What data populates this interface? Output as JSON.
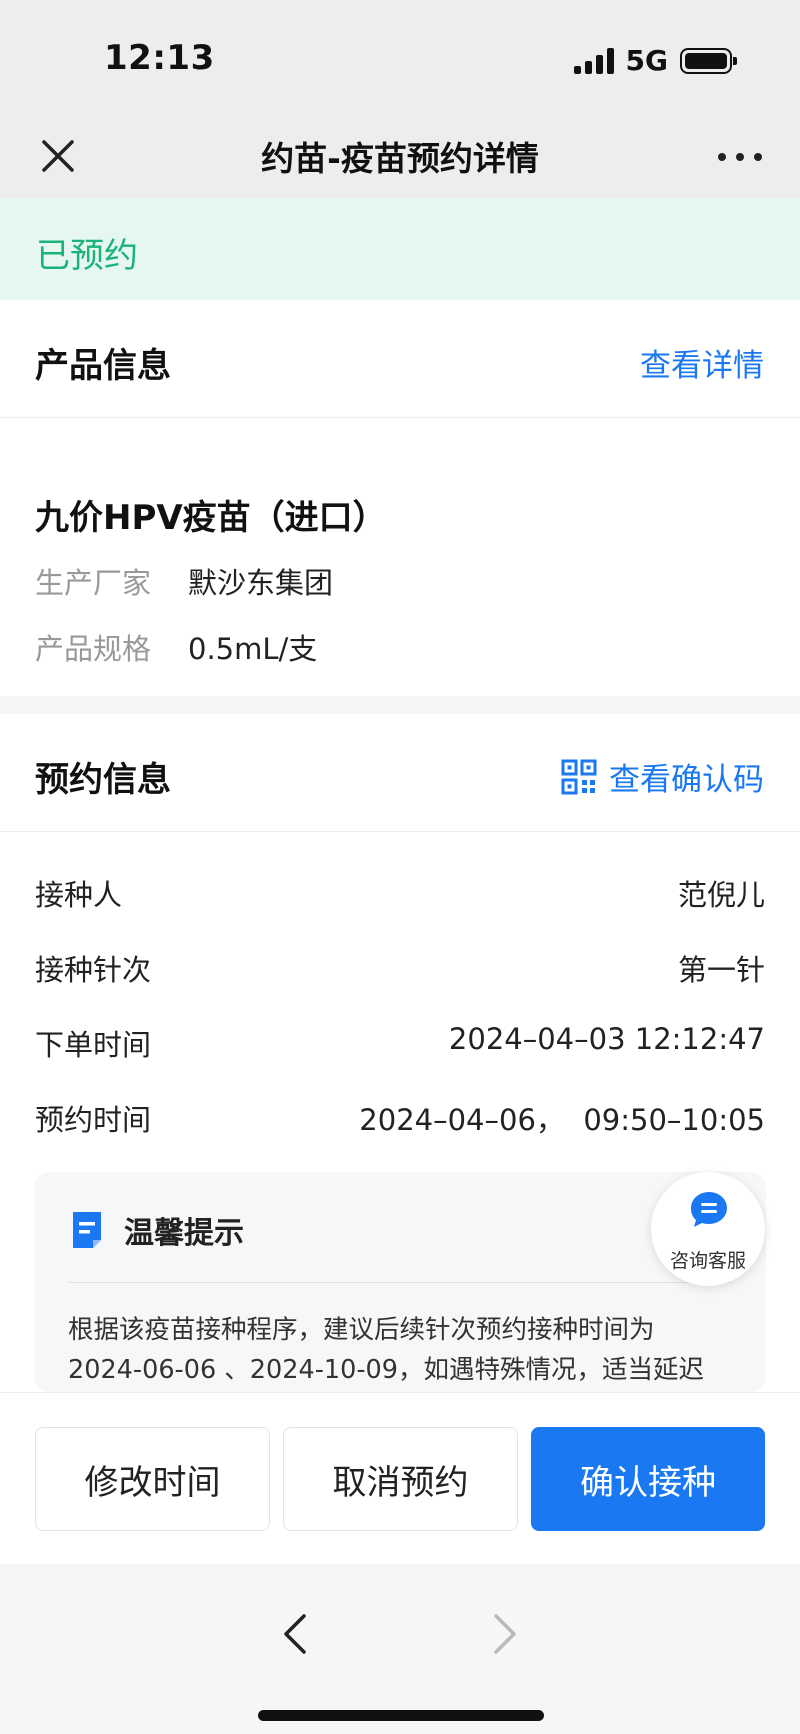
{
  "status_bar": {
    "time": "12:13",
    "network": "5G",
    "battery_level": 1.0
  },
  "nav": {
    "title": "约苗-疫苗预约详情",
    "close_icon": "close-icon",
    "more_icon": "more-icon"
  },
  "banner": {
    "status": "已预约",
    "color": "#1bb37a"
  },
  "product": {
    "section_title": "产品信息",
    "detail_link": "查看详情",
    "name": "九价HPV疫苗（进口）",
    "fields": [
      {
        "key": "生产厂家",
        "value": "默沙东集团"
      },
      {
        "key": "产品规格",
        "value": "0.5mL/支"
      }
    ]
  },
  "appointment": {
    "section_title": "预约信息",
    "code_link": "查看确认码",
    "code_icon": "qr-code-icon",
    "rows": [
      {
        "key": "接种人",
        "value": "范倪儿"
      },
      {
        "key": "接种针次",
        "value": "第一针"
      },
      {
        "key": "下单时间",
        "value": "2024–04–03 12:12:47"
      },
      {
        "key": "预约时间",
        "value": "2024–04–06，  09:50–10:05"
      }
    ]
  },
  "tip": {
    "title": "温馨提示",
    "icon": "document-icon",
    "line1": "根据该疫苗接种程序，建议后续针次预约接种时间为",
    "line2": "2024-06-06 、2024-10-09，如遇特殊情况，适当延迟"
  },
  "customer_service": {
    "label": "咨询客服",
    "icon": "chat-bubble-icon"
  },
  "actions": {
    "modify": "修改时间",
    "cancel": "取消预约",
    "confirm": "确认接种",
    "primary_color": "#1a78f2"
  },
  "browser_nav": {
    "back_icon": "chevron-left-icon",
    "forward_icon": "chevron-right-icon"
  }
}
